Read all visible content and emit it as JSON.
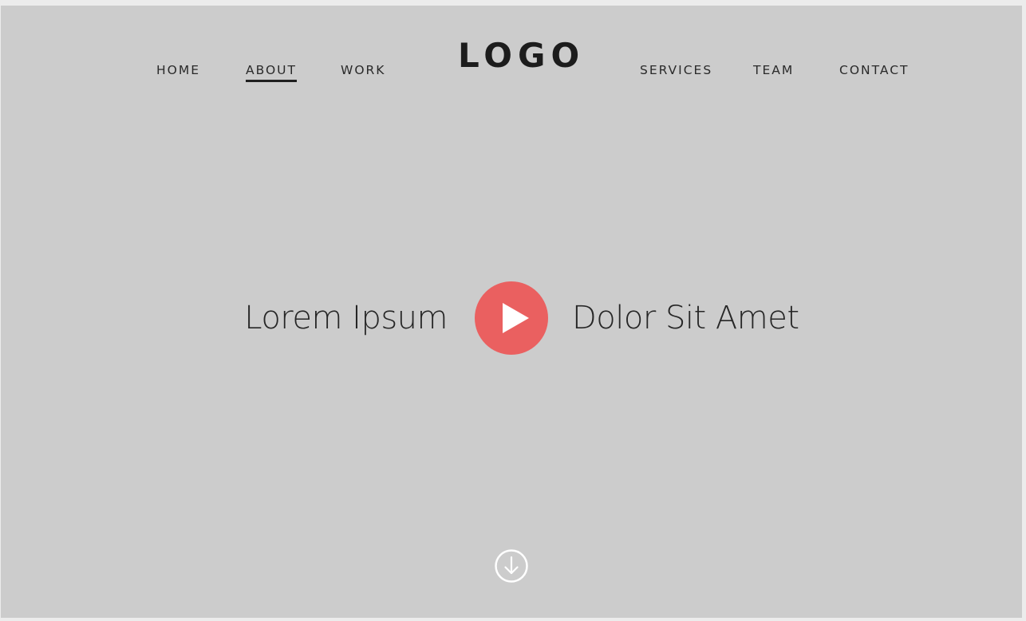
{
  "nav": {
    "left": [
      {
        "label": "HOME"
      },
      {
        "label": "ABOUT",
        "active": true
      },
      {
        "label": "WORK"
      }
    ],
    "right": [
      {
        "label": "SERVICES"
      },
      {
        "label": "TEAM"
      },
      {
        "label": "CONTACT"
      }
    ]
  },
  "logo": {
    "text": "LOGO"
  },
  "hero": {
    "left_text": "Lorem Ipsum",
    "right_text": "Dolor Sit Amet",
    "play_icon": "play-icon"
  },
  "scroll": {
    "icon": "arrow-down-circle-icon"
  },
  "colors": {
    "background": "#cccccc",
    "accent": "#ea6060",
    "text": "#262626"
  }
}
